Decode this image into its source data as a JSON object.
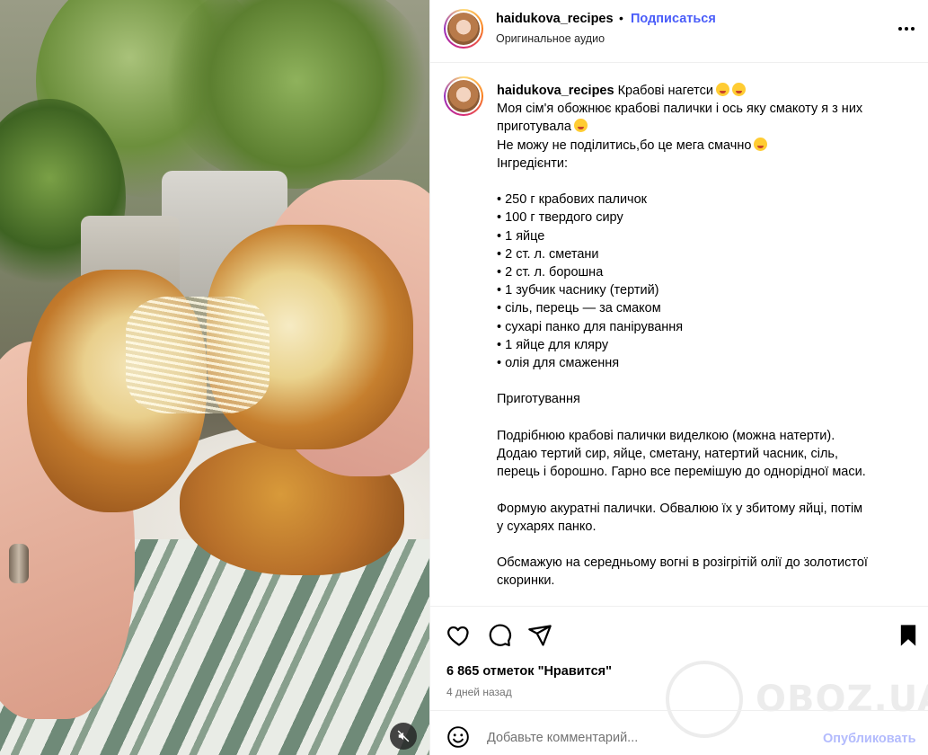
{
  "post": {
    "username": "haidukova_recipes",
    "dot": "•",
    "follow_label": "Подписаться",
    "audio": "Оригинальное аудио",
    "more_icon": "more-horizontal-icon"
  },
  "caption": {
    "username": "haidukova_recipes",
    "title": "Крабові нагетси",
    "lines": [
      "Моя сім'я обожнює крабові палички і ось яку смакоту я з них",
      "приготувала",
      "Не можу не поділитись,бо це мега смачно",
      "Інгредієнти:",
      "",
      "• 250 г крабових паличок",
      "• 100 г твердого сиру",
      "• 1 яйце",
      "• 2 ст. л. сметани",
      "• 2 ст. л. борошна",
      "• 1 зубчик часнику (тертий)",
      "• сіль, перець — за смаком",
      "• сухарі панко для панірування",
      "• 1 яйце для кляру",
      "• олія для смаження",
      "",
      "Приготування",
      "",
      "Подрібнюю крабові палички виделкою (можна натерти).",
      "Додаю тертий сир, яйце, сметану, натертий часник, сіль,",
      "перець і борошно. Гарно все перемішую до однорідної маси.",
      "",
      "Формую акуратні палички. Обвалюю їх у збитому яйці, потім",
      "у сухарях панко.",
      "",
      "Обсмажую на середньому вогні в розігрітій олії до золотистої",
      "скоринки."
    ]
  },
  "actions": {
    "likes": "6 865 отметок \"Нравится\"",
    "time": "4 дней назад",
    "icons": [
      "heart-icon",
      "comment-icon",
      "share-icon",
      "bookmark-icon"
    ]
  },
  "watermark": {
    "text": "OBOZ.UA"
  },
  "comment": {
    "placeholder": "Добавьте комментарий...",
    "post_label": "Опубликовать"
  },
  "colors": {
    "link_blue": "#4a5df9",
    "post_disabled": "#b3bbfd",
    "muted": "#737373",
    "divider": "#efefef"
  }
}
